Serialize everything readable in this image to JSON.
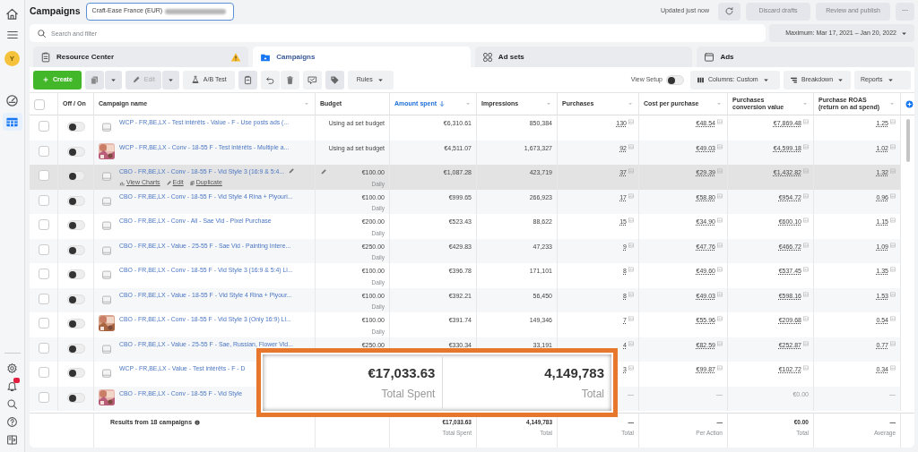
{
  "sidebar": {
    "avatar_letter": "Y",
    "items": [
      {
        "kind": "gauge",
        "selected": false
      },
      {
        "kind": "table",
        "selected": true
      }
    ]
  },
  "header": {
    "title": "Campaigns",
    "account": "Craft-Ease France (EUR)",
    "updated": "Updated just now",
    "discard": {
      "label": "Discard drafts",
      "disabled": true
    },
    "publish": {
      "label": "Review and publish",
      "disabled": true
    },
    "more": "···"
  },
  "search": {
    "placeholder": "Search and filter"
  },
  "date_range": "Maximum: Mar 17, 2021 – Jan 20, 2022",
  "tabs": [
    {
      "label": "Resource Center",
      "kind": "resource",
      "selected": false,
      "warning": true
    },
    {
      "label": "Campaigns",
      "kind": "campaigns",
      "selected": true,
      "warning": false
    },
    {
      "label": "Ad sets",
      "kind": "adsets",
      "selected": false,
      "warning": false
    },
    {
      "label": "Ads",
      "kind": "ads",
      "selected": false,
      "warning": false
    }
  ],
  "toolbar": {
    "create": "Create",
    "duplicate_disabled": true,
    "edit": {
      "label": "Edit",
      "disabled": true
    },
    "ab_test": "A/B Test",
    "rules": "Rules",
    "view_setup": {
      "label": "View Setup",
      "on": false
    },
    "columns": "Columns: Custom",
    "breakdown": "Breakdown",
    "reports": "Reports"
  },
  "table": {
    "select_all": {
      "checked": false
    },
    "columns": [
      {
        "label": "Off / On",
        "menu": false,
        "sorted": false
      },
      {
        "label": "Campaign name",
        "menu": true,
        "sorted": false
      },
      {
        "label": "Budget",
        "menu": false,
        "sorted": false
      },
      {
        "label": "Amount spent",
        "menu": true,
        "sorted": true
      },
      {
        "label": "Impressions",
        "menu": true,
        "sorted": false
      },
      {
        "label": "Purchases",
        "menu": true,
        "sorted": false
      },
      {
        "label": "Cost per purchase",
        "menu": true,
        "sorted": false
      },
      {
        "label": "Purchases conversion value",
        "menu": true,
        "sorted": false
      },
      {
        "label": "Purchase ROAS (return on ad spend)",
        "menu": true,
        "sorted": false
      }
    ],
    "rows": [
      {
        "checked": false,
        "on": false,
        "highlighted": false,
        "thumbnail": {
          "kind": "placeholder"
        },
        "has_results": true,
        "name": "WCP - FR,BE,LX - Test intérêts - Value - F - Use posts ads (...",
        "budget": "Using ad set budget",
        "amount_spent": "€6,310.61",
        "impressions": "850,384",
        "purchases": "130",
        "cost_per_purchase": "€48.54",
        "conversion_value": "€7,869.48",
        "roas": "1.25"
      },
      {
        "checked": false,
        "on": false,
        "highlighted": false,
        "has_results": true,
        "name": "WCP - FR,BE,LX - Conv - 18-55 F - Test intérêts - Multiple a...",
        "budget": "Using ad set budget",
        "amount_spent": "€4,511.07",
        "impressions": "1,673,327",
        "purchases": "92",
        "cost_per_purchase": "€49.03",
        "conversion_value": "€4,599.18",
        "roas": "1.02"
      },
      {
        "checked": false,
        "on": false,
        "highlighted": true,
        "thumbnail": {
          "kind": "placeholder"
        },
        "has_results": true,
        "name": "CBO - FR,BE,LX - Conv - 18-55 F - Vid Style 3 (16:9 & 5:4...",
        "actions": [
          {
            "kind": "charts",
            "label": "View Charts"
          },
          {
            "kind": "edit",
            "label": "Edit"
          },
          {
            "kind": "duplicate",
            "label": "Duplicate"
          }
        ],
        "budget": "€100.00",
        "budget_note": "Daily",
        "amount_spent": "€1,087.28",
        "impressions": "423,719",
        "purchases": "37",
        "cost_per_purchase": "€29.39",
        "conversion_value": "€1,432.82",
        "roas": "1.32"
      },
      {
        "checked": false,
        "on": false,
        "highlighted": false,
        "thumbnail": {
          "kind": "placeholder"
        },
        "has_results": true,
        "name": "CBO - FR,BE,LX - Conv - 18-55 F - Vid Style 4 Rina + Piyouri...",
        "budget": "€100.00",
        "budget_note": "Daily",
        "amount_spent": "€999.65",
        "impressions": "266,923",
        "purchases": "17",
        "cost_per_purchase": "€58.80",
        "conversion_value": "€954.72",
        "roas": "0.96"
      },
      {
        "checked": false,
        "on": false,
        "highlighted": false,
        "thumbnail": {
          "kind": "placeholder"
        },
        "has_results": true,
        "name": "CBO - FR,BE,LX - Conv - All - Sae Vid - Pixel Purchase",
        "budget": "€200.00",
        "budget_note": "Daily",
        "amount_spent": "€523.43",
        "impressions": "88,622",
        "purchases": "15",
        "cost_per_purchase": "€34.90",
        "conversion_value": "€600.10",
        "roas": "1.15"
      },
      {
        "checked": false,
        "on": false,
        "highlighted": false,
        "thumbnail": {
          "kind": "placeholder"
        },
        "has_results": true,
        "name": "CBO - FR,BE,LX - Value - 25-55 F - Sae Vid - Painting Intere...",
        "budget": "€250.00",
        "budget_note": "Daily",
        "amount_spent": "€429.83",
        "impressions": "47,233",
        "purchases": "9",
        "cost_per_purchase": "€47.76",
        "conversion_value": "€466.72",
        "roas": "1.09"
      },
      {
        "checked": false,
        "on": false,
        "highlighted": false,
        "thumbnail": {
          "kind": "placeholder"
        },
        "has_results": true,
        "name": "CBO - FR,BE,LX - Conv - 18-55 F - Vid Style 3 (16:9 & 5:4) Ll...",
        "budget": "€100.00",
        "budget_note": "Daily",
        "amount_spent": "€396.78",
        "impressions": "171,101",
        "purchases": "8",
        "cost_per_purchase": "€49.60",
        "conversion_value": "€537.45",
        "roas": "1.35"
      },
      {
        "checked": false,
        "on": false,
        "highlighted": false,
        "thumbnail": {
          "kind": "placeholder"
        },
        "has_results": true,
        "name": "CBO - FR,BE,LX - Value - 18-55 F - Vid Style 4 Rina + Piyour...",
        "budget": "€100.00",
        "budget_note": "Daily",
        "amount_spent": "€392.21",
        "impressions": "56,450",
        "purchases": "8",
        "cost_per_purchase": "€49.03",
        "conversion_value": "€598.16",
        "roas": "1.53"
      },
      {
        "checked": false,
        "on": false,
        "highlighted": false,
        "has_results": true,
        "name": "CBO - FR,BE,LX - Conv - 18-55 F - Vid Style 3 (Only 16:9) Ll...",
        "budget": "€100.00",
        "budget_note": "Daily",
        "amount_spent": "€391.74",
        "impressions": "149,346",
        "purchases": "7",
        "cost_per_purchase": "€55.96",
        "conversion_value": "€209.68",
        "roas": "0.54"
      },
      {
        "checked": false,
        "on": false,
        "highlighted": false,
        "thumbnail": {
          "kind": "placeholder"
        },
        "has_results": true,
        "name": "CBO - FR,BE,LX - Value - 25-55 F - Sae, Russian, Flower Vid...",
        "budget": "€250.00",
        "amount_spent": "€330.34",
        "impressions": "33,191",
        "purchases": "4",
        "cost_per_purchase": "€82.59",
        "conversion_value": "€252.87",
        "roas": "0.77"
      },
      {
        "checked": false,
        "on": false,
        "highlighted": false,
        "thumbnail": {
          "kind": "placeholder"
        },
        "has_results": true,
        "name": "WCP - FR,BE,LX - Value - Test intérêts - F - D",
        "purchases": "3",
        "cost_per_purchase": "€99.87",
        "conversion_value": "€102.72",
        "roas": "0.34"
      },
      {
        "checked": false,
        "on": false,
        "highlighted": false,
        "has_results": false,
        "name": "CBO - FR,BE,LX - Conv - 18-55 F - Vid Style",
        "purchases": "—",
        "cost_per_purchase": "—",
        "conversion_value": "€0.00",
        "roas": "—"
      }
    ],
    "footer": {
      "results": "Results from 18 campaigns",
      "totals": [
        {
          "value": "€17,033.63",
          "label": "Total Spent"
        },
        {
          "value": "4,149,783",
          "label": "Total"
        },
        {
          "value": "—",
          "label": "Total"
        },
        {
          "value": "—",
          "label": "Per Action"
        },
        {
          "value": "€0.00",
          "label": "Total"
        },
        {
          "value": "—",
          "label": "Average"
        }
      ]
    }
  },
  "callout": [
    {
      "value": "€17,033.63",
      "label": "Total Spent"
    },
    {
      "value": "4,149,783",
      "label": "Total"
    }
  ]
}
